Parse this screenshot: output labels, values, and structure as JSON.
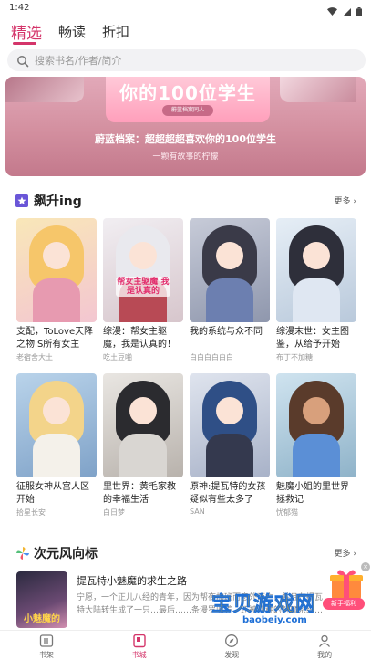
{
  "status_bar": {
    "time": "1:42"
  },
  "tabs": [
    {
      "label": "精选",
      "active": true
    },
    {
      "label": "畅读",
      "active": false
    },
    {
      "label": "折扣",
      "active": false
    }
  ],
  "search": {
    "placeholder": "搜索书名/作者/简介"
  },
  "banner": {
    "card_title": "你的100位学生",
    "card_chip": "蔚蓝档案同人",
    "title": "蔚蓝档案：超超超超喜欢你的100位学生",
    "subtitle": "一颗有故事的柠檬"
  },
  "section_rising": {
    "title": "飙升ing",
    "more": "更多",
    "books": [
      {
        "title": "支配，ToLove天降之物IS所有女主",
        "author": "老宿舍大土",
        "palette": [
          "#f6c66a",
          "#f9d9e4",
          "#e79ab0"
        ]
      },
      {
        "title": "综漫：帮女主驱魔，我是认真的！",
        "author": "吃土豆啪",
        "palette": [
          "#e9e9ee",
          "#fbe3d6",
          "#b84a55"
        ],
        "badge": "帮女主驱魔 我是认真的"
      },
      {
        "title": "我的系统与众不同",
        "author": "白白白白白白",
        "palette": [
          "#3a3a48",
          "#fbe3d6",
          "#6c7fb0"
        ]
      },
      {
        "title": "综漫末世：女主图鉴，从给予开始",
        "author": "布丁不加糖",
        "palette": [
          "#2e2f3a",
          "#fbe3d6",
          "#dfe7f2"
        ]
      },
      {
        "title": "征服女神从宫人区开始",
        "author": "拾星长安",
        "palette": [
          "#f3d48a",
          "#fbe3d6",
          "#f4f1ea"
        ]
      },
      {
        "title": "里世界：黄毛家教的幸福生活",
        "author": "白日梦",
        "palette": [
          "#2b2b2f",
          "#fbe3d6",
          "#d9d6d2"
        ]
      },
      {
        "title": "原神:提瓦特的女孩疑似有些太多了",
        "author": "SAN",
        "palette": [
          "#2f4f86",
          "#fbe3d6",
          "#34394e"
        ]
      },
      {
        "title": "魅魔小姐的里世界拯救记",
        "author": "忧郁猫",
        "palette": [
          "#5a3b2b",
          "#d8a07c",
          "#5b8fd6"
        ]
      }
    ]
  },
  "section_trend": {
    "title": "次元风向标",
    "more": "更多",
    "item": {
      "title": "提瓦特小魅魔的求生之路",
      "description": "宁愿，一个正儿八经的青年，因为帮夜加班而意外死亡，并且在提瓦特大陆转生成了一只…最后……条漫罗收养，还被那种的魅魔系统…",
      "cover_text": "小魅魔的"
    }
  },
  "watermark": {
    "text": "宝贝游戏网",
    "url": "baobeiy.com"
  },
  "gift": {
    "label": "新手福利",
    "close": "×"
  },
  "bottom_nav": [
    {
      "label": "书架",
      "active": false
    },
    {
      "label": "书城",
      "active": true
    },
    {
      "label": "发现",
      "active": false
    },
    {
      "label": "我的",
      "active": false
    }
  ],
  "colors": {
    "accent": "#d4356a",
    "banner": "#d38f9f"
  }
}
